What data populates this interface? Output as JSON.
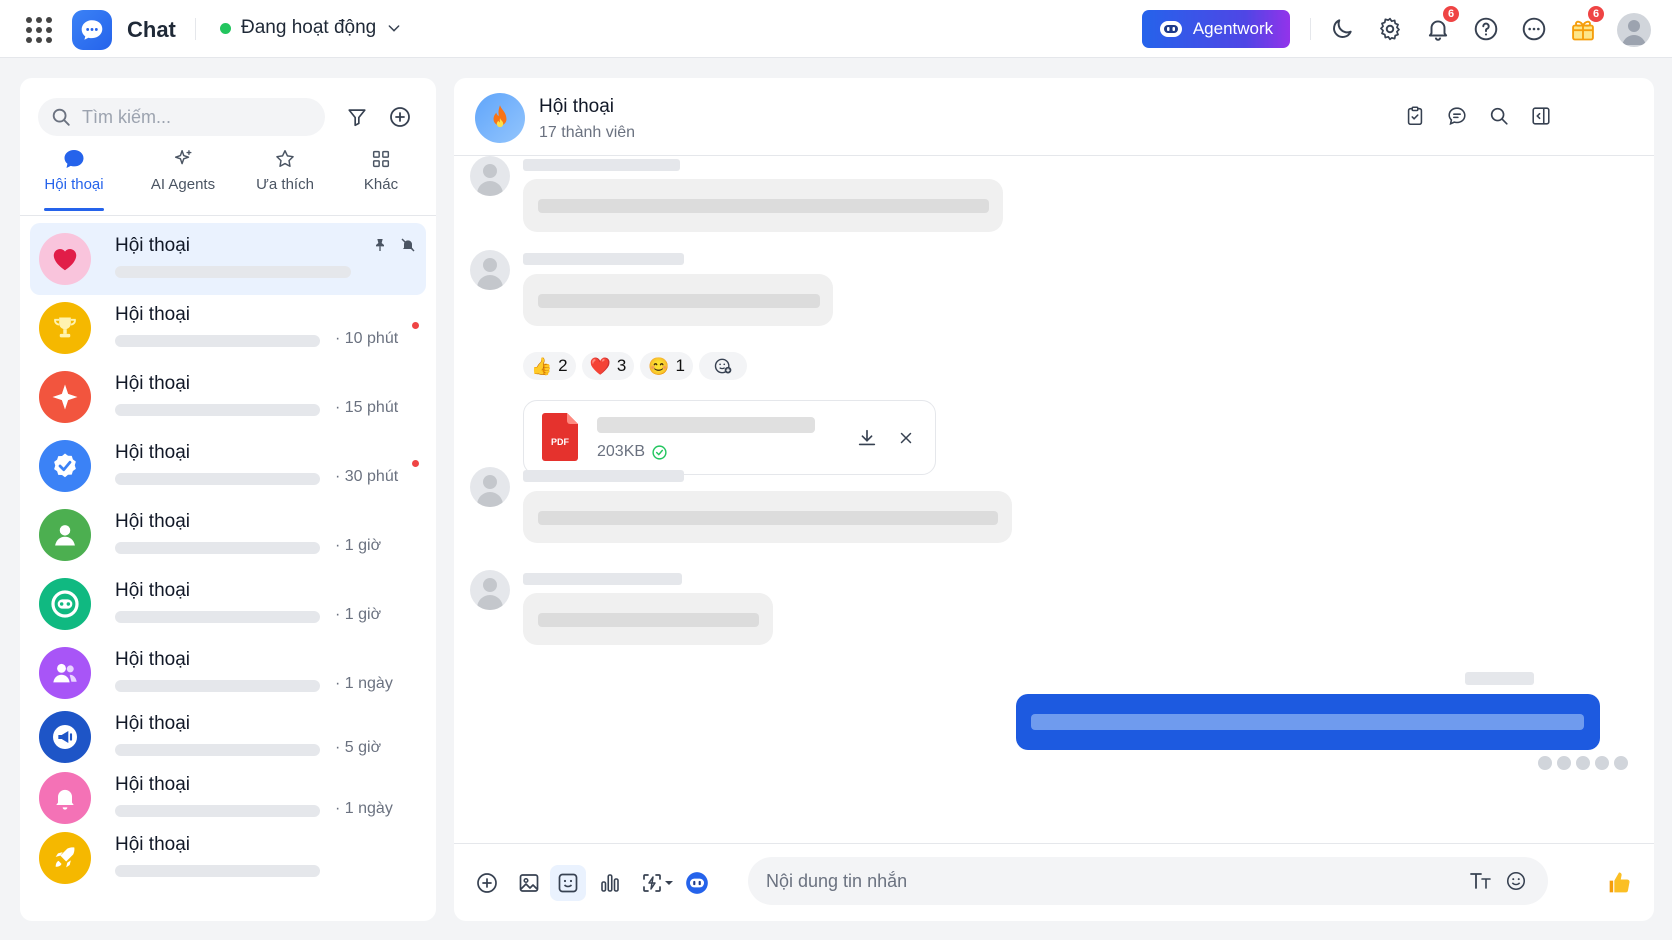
{
  "app": {
    "name": "Chat"
  },
  "status": {
    "label": "Đang hoạt động",
    "color": "#22c55e"
  },
  "topbar": {
    "agentwork_label": "Agentwork",
    "notification_badge": "6",
    "gift_badge": "6"
  },
  "sidebar": {
    "search_placeholder": "Tìm kiếm...",
    "tabs": [
      {
        "label": "Hội thoại",
        "icon": "chat-bubble-icon",
        "active": true
      },
      {
        "label": "AI Agents",
        "icon": "sparkle-icon"
      },
      {
        "label": "Ưa thích",
        "icon": "star-icon"
      },
      {
        "label": "Khác",
        "icon": "grid-icon"
      }
    ],
    "conversations": [
      {
        "name": "Hội thoại",
        "time": "",
        "avatar": "heart",
        "color": "#f9a8d4",
        "pinned": true,
        "muted": true,
        "unread": false
      },
      {
        "name": "Hội thoại",
        "time": "· 10 phút",
        "avatar": "trophy",
        "color": "#f5b800",
        "unread": true
      },
      {
        "name": "Hội thoại",
        "time": "· 15 phút",
        "avatar": "sparkle",
        "color": "#f2553e",
        "unread": false
      },
      {
        "name": "Hội thoại",
        "time": "· 30 phút",
        "avatar": "verified",
        "color": "#3b82f6",
        "unread": true
      },
      {
        "name": "Hội thoại",
        "time": "· 1 giờ",
        "avatar": "user",
        "color": "#4caf50",
        "unread": false
      },
      {
        "name": "Hội thoại",
        "time": "· 1 giờ",
        "avatar": "bot",
        "color": "#10b981",
        "unread": false
      },
      {
        "name": "Hội thoại",
        "time": "· 1 ngày",
        "avatar": "group",
        "color": "#a855f7",
        "unread": false
      },
      {
        "name": "Hội thoại",
        "time": "· 5 giờ",
        "avatar": "megaphone",
        "color": "#1e55c7",
        "unread": false
      },
      {
        "name": "Hội thoại",
        "time": "· 1 ngày",
        "avatar": "bell",
        "color": "#f472b6",
        "unread": false
      },
      {
        "name": "Hội thoại",
        "time": "",
        "avatar": "rocket",
        "color": "#f5b800",
        "unread": false
      }
    ]
  },
  "chat": {
    "title": "Hội thoại",
    "subtitle": "17 thành viên",
    "reactions": [
      {
        "emoji": "👍",
        "count": "2"
      },
      {
        "emoji": "❤️",
        "count": "3"
      },
      {
        "emoji": "😊",
        "count": "1"
      }
    ],
    "file": {
      "type": "PDF",
      "size": "203KB"
    },
    "composer_placeholder": "Nội dung tin nhắn"
  }
}
